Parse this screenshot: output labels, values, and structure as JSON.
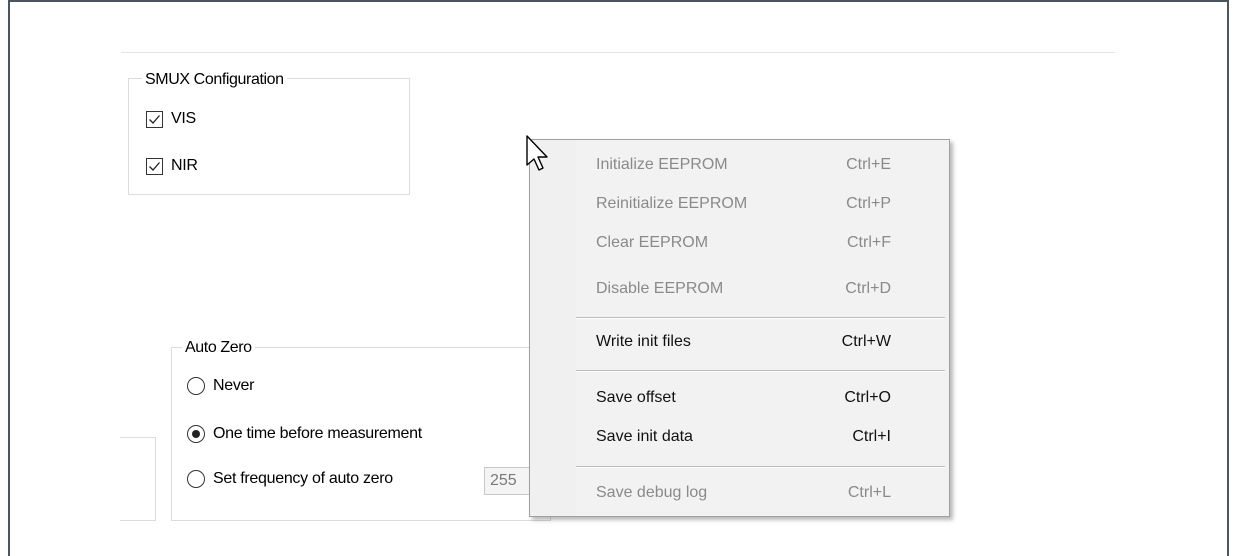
{
  "smux": {
    "legend": "SMUX Configuration",
    "items": [
      {
        "label": "VIS",
        "checked": true
      },
      {
        "label": "NIR",
        "checked": true
      }
    ]
  },
  "auto_zero": {
    "legend": "Auto Zero",
    "options": [
      {
        "label": "Never",
        "selected": false
      },
      {
        "label": "One time before measurement",
        "selected": true
      },
      {
        "label": "Set frequency of auto zero",
        "selected": false
      }
    ],
    "frequency_value": "255"
  },
  "context_menu": {
    "items": [
      {
        "label": "Initialize EEPROM",
        "shortcut": "Ctrl+E",
        "enabled": false
      },
      {
        "label": "Reinitialize EEPROM",
        "shortcut": "Ctrl+P",
        "enabled": false
      },
      {
        "label": "Clear EEPROM",
        "shortcut": "Ctrl+F",
        "enabled": false
      },
      {
        "label": "Disable EEPROM",
        "shortcut": "Ctrl+D",
        "enabled": false
      },
      {
        "label": "Write init files",
        "shortcut": "Ctrl+W",
        "enabled": true
      },
      {
        "label": "Save offset",
        "shortcut": "Ctrl+O",
        "enabled": true
      },
      {
        "label": "Save init data",
        "shortcut": "Ctrl+I",
        "enabled": true
      },
      {
        "label": "Save debug log",
        "shortcut": "Ctrl+L",
        "enabled": false
      }
    ]
  },
  "colors": {
    "menu_background": "#f2f2f2",
    "disabled_text": "#8a8a8a",
    "frame_border": "#4a5560"
  }
}
